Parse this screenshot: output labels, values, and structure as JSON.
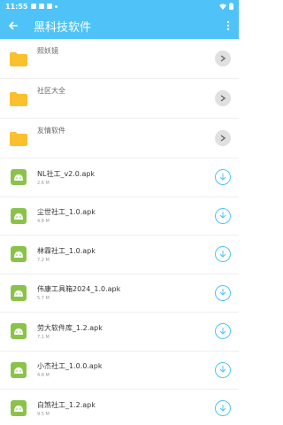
{
  "status_bar": {
    "time": "11:55"
  },
  "app_bar": {
    "title": "黑科技软件"
  },
  "folders": [
    {
      "name": "照妖镜"
    },
    {
      "name": "社区大全"
    },
    {
      "name": "友情软件"
    }
  ],
  "files": [
    {
      "name": "NL社工_v2.0.apk",
      "size": "2.6 M"
    },
    {
      "name": "尘世社工_1.0.apk",
      "size": "4.8 M"
    },
    {
      "name": "林霖社工_1.0.apk",
      "size": "7.2 M"
    },
    {
      "name": "伟康工具箱2024_1.0.apk",
      "size": "5.7 M"
    },
    {
      "name": "劳大软件库_1.2.apk",
      "size": "7.1 M"
    },
    {
      "name": "小杰社工_1.0.0.apk",
      "size": "4.8 M"
    },
    {
      "name": "白煞社工_1.2.apk",
      "size": "9.5 M"
    }
  ],
  "colors": {
    "accent": "#4fc3f7",
    "folder": "#fbc02d",
    "apk": "#8bc34a"
  },
  "icons": {
    "back": "arrow-left-icon",
    "more": "more-vert-icon",
    "folder": "folder-icon",
    "open": "chevron-right-icon",
    "apk": "android-icon",
    "download": "download-icon"
  }
}
